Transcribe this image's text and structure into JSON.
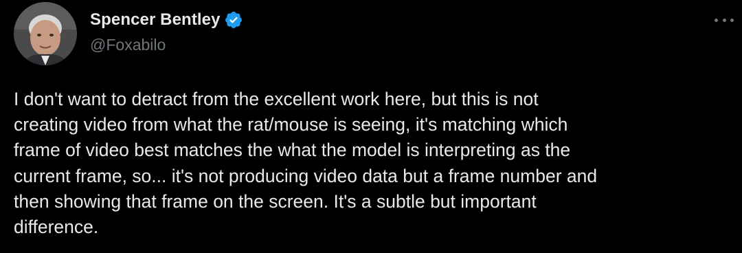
{
  "author": {
    "display_name": "Spencer Bentley",
    "handle": "@Foxabilo",
    "verified": true
  },
  "menu": {
    "icon": "more-horizontal-icon"
  },
  "tweet": {
    "lines": [
      "I don't want to detract from the excellent work here, but this is not",
      "creating video from what the rat/mouse is seeing, it's matching which",
      "frame of video best matches the what the model is interpreting as the",
      "current frame, so... it's not producing video data but a frame number and",
      "then showing that frame on the screen. It's a subtle but important",
      "difference."
    ]
  },
  "colors": {
    "background": "#000000",
    "primary_text": "#e7e9ea",
    "secondary_text": "#71767b",
    "verified_badge": "#1d9bf0"
  }
}
